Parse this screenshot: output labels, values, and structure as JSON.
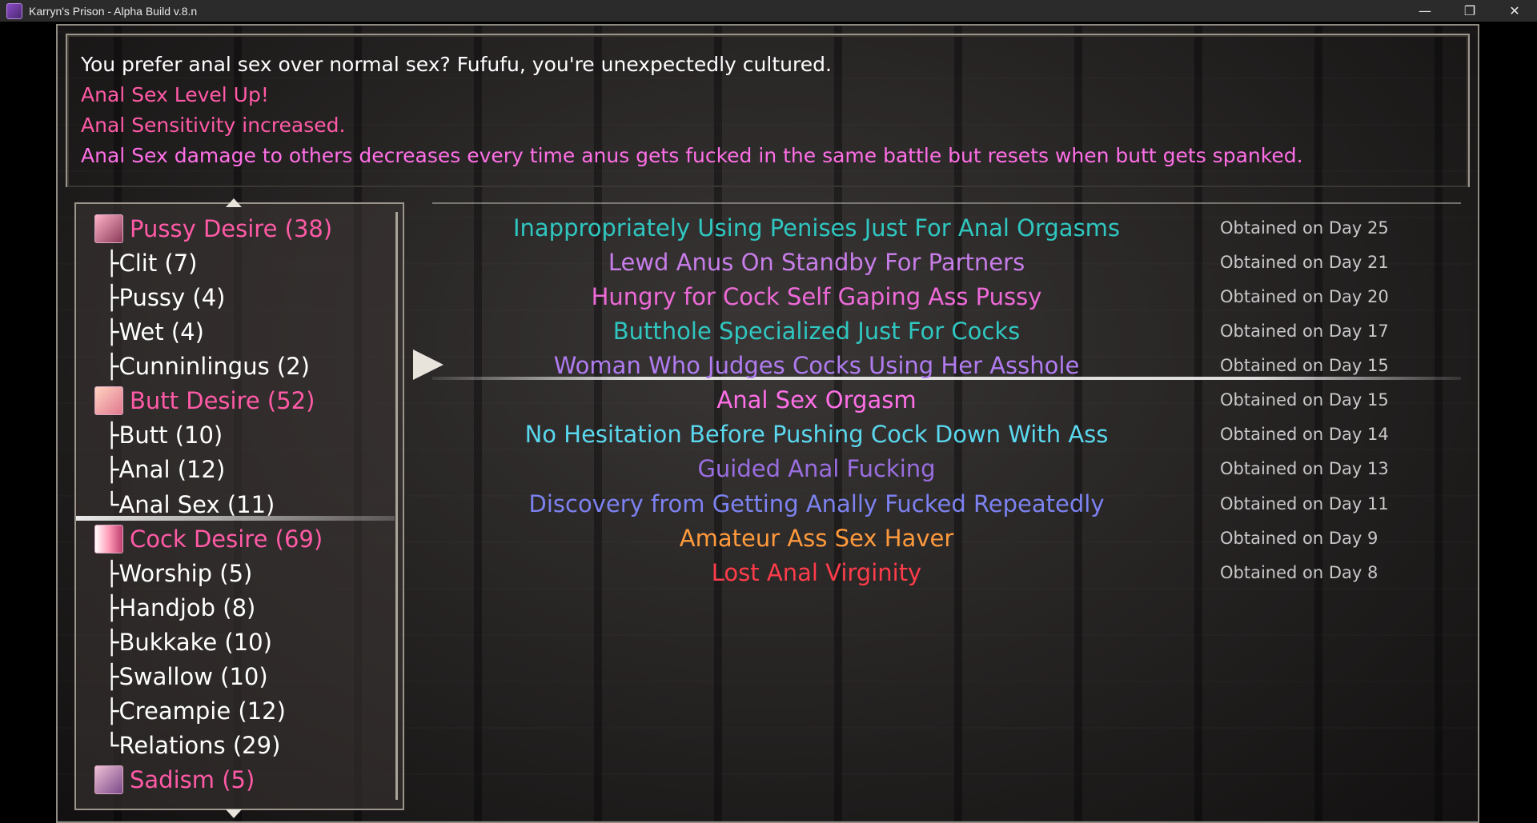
{
  "window": {
    "title": "Karryn's Prison - Alpha Build v.8.n",
    "minimize": "—",
    "maximize": "❐",
    "close": "✕"
  },
  "message": {
    "line1": "You prefer anal sex over normal sex? Fufufu, you're unexpectedly cultured.",
    "line2": "Anal Sex Level Up!",
    "line3": "Anal Sensitivity increased.",
    "line4": "Anal Sex damage to others decreases every time anus gets fucked in the same battle but resets when butt gets spanked."
  },
  "categories": [
    {
      "label": "Pussy Desire (38)",
      "type": "main",
      "icon": "pussy-desire-icon"
    },
    {
      "label": "├Clit (7)",
      "type": "sub"
    },
    {
      "label": "├Pussy (4)",
      "type": "sub"
    },
    {
      "label": "├Wet (4)",
      "type": "sub"
    },
    {
      "label": "├Cunninlingus (2)",
      "type": "sub"
    },
    {
      "label": "Butt Desire (52)",
      "type": "main",
      "icon": "butt-desire-icon"
    },
    {
      "label": "├Butt (10)",
      "type": "sub"
    },
    {
      "label": "├Anal (12)",
      "type": "sub"
    },
    {
      "label": "└Anal Sex (11)",
      "type": "sub",
      "selected": true
    },
    {
      "label": "Cock Desire (69)",
      "type": "main",
      "icon": "cock-desire-icon"
    },
    {
      "label": "├Worship (5)",
      "type": "sub"
    },
    {
      "label": "├Handjob (8)",
      "type": "sub"
    },
    {
      "label": "├Bukkake (10)",
      "type": "sub"
    },
    {
      "label": "├Swallow (10)",
      "type": "sub"
    },
    {
      "label": "├Creampie (12)",
      "type": "sub"
    },
    {
      "label": "└Relations (29)",
      "type": "sub"
    },
    {
      "label": "Sadism (5)",
      "type": "main",
      "icon": "sadism-icon"
    }
  ],
  "titles": [
    {
      "name": "Inappropriately Using Penises Just For Anal Orgasms",
      "date": "Obtained on Day 25",
      "color": "#2fc7c0"
    },
    {
      "name": "Lewd Anus On Standby For Partners",
      "date": "Obtained on Day 21",
      "color": "#c77de8"
    },
    {
      "name": "Hungry for Cock Self Gaping Ass Pussy",
      "date": "Obtained on Day 20",
      "color": "#ee6ad8"
    },
    {
      "name": "Butthole Specialized Just For Cocks",
      "date": "Obtained on Day 17",
      "color": "#2fc7c0"
    },
    {
      "name": "Woman Who Judges Cocks Using Her Asshole",
      "date": "Obtained on Day 15",
      "color": "#b07cf0",
      "selected": true
    },
    {
      "name": "Anal Sex Orgasm",
      "date": "Obtained on Day 15",
      "color": "#ff6fe6"
    },
    {
      "name": "No Hesitation Before Pushing Cock Down With Ass",
      "date": "Obtained on Day 14",
      "color": "#5ad8ee"
    },
    {
      "name": "Guided Anal Fucking",
      "date": "Obtained on Day 13",
      "color": "#9a6ee0"
    },
    {
      "name": "Discovery from Getting Anally Fucked Repeatedly",
      "date": "Obtained on Day 11",
      "color": "#7c82f0"
    },
    {
      "name": "Amateur Ass Sex Haver",
      "date": "Obtained on Day 9",
      "color": "#ff9a3c"
    },
    {
      "name": "Lost Anal Virginity",
      "date": "Obtained on Day 8",
      "color": "#ff3c4a"
    }
  ]
}
